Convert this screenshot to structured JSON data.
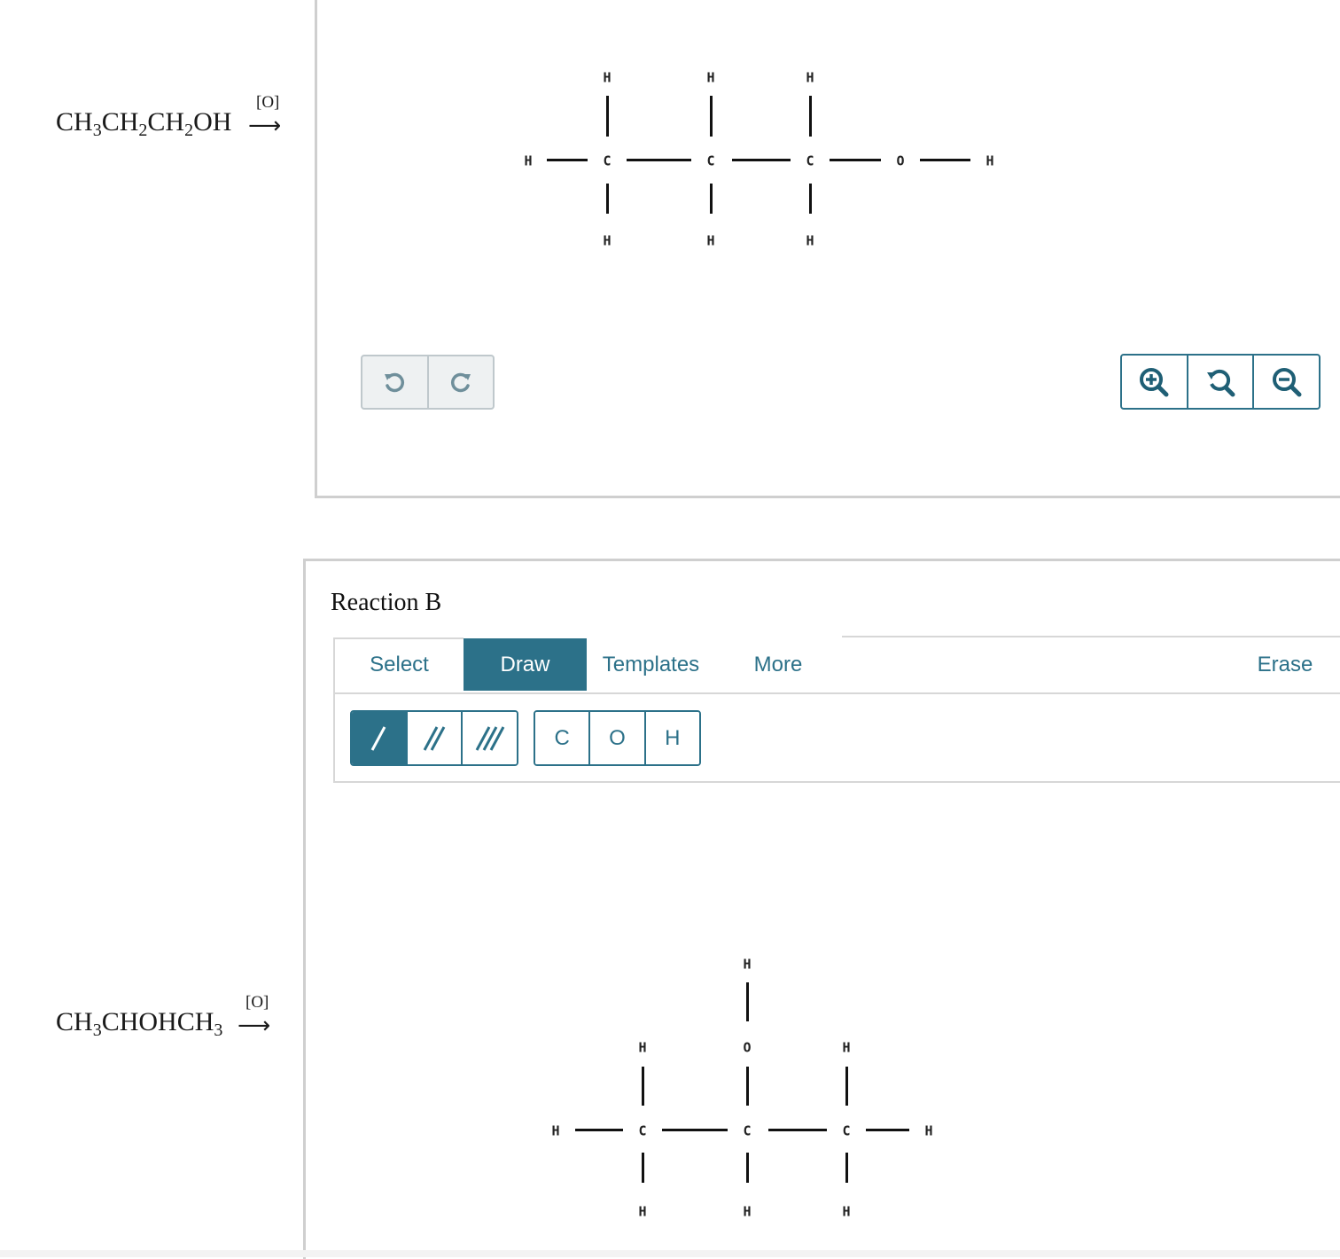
{
  "reaction_a": {
    "formula": {
      "p1": "CH",
      "s1": "3",
      "p2": "CH",
      "s2": "2",
      "p3": "CH",
      "s3": "2",
      "p4": "OH"
    },
    "reagent": "[O]",
    "arrow": "⟶",
    "canvas": {
      "atoms": {
        "h1": "H",
        "c1": "C",
        "h2": "H",
        "h3": "H",
        "c2": "C",
        "h4": "H",
        "h5": "H",
        "c3": "C",
        "h6": "H",
        "h7": "H",
        "o1": "O",
        "h8": "H"
      }
    },
    "undo_icon": "undo-icon",
    "redo_icon": "redo-icon",
    "zoom_in_icon": "zoom-in-icon",
    "zoom_reset_icon": "zoom-reset-icon",
    "zoom_out_icon": "zoom-out-icon"
  },
  "reaction_b": {
    "title": "Reaction B",
    "formula": {
      "p1": "CH",
      "s1": "3",
      "p2": "CHOHCH",
      "s2": "3"
    },
    "reagent": "[O]",
    "arrow": "⟶",
    "tabs": {
      "select": "Select",
      "draw": "Draw",
      "templates": "Templates",
      "more": "More",
      "erase": "Erase"
    },
    "active_tab": "Draw",
    "bond_tools": [
      "single-bond-icon",
      "double-bond-icon",
      "triple-bond-icon"
    ],
    "atom_tools": [
      "C",
      "O",
      "H"
    ],
    "canvas": {
      "atoms": {
        "h1": "H",
        "c1": "C",
        "h2": "H",
        "h3": "H",
        "c2": "C",
        "o1": "O",
        "h4": "H",
        "h5": "H",
        "c3": "C",
        "h6": "H",
        "h7": "H",
        "h8": "H"
      }
    }
  },
  "colors": {
    "accent": "#2c7189",
    "border": "#cfcfcf"
  }
}
